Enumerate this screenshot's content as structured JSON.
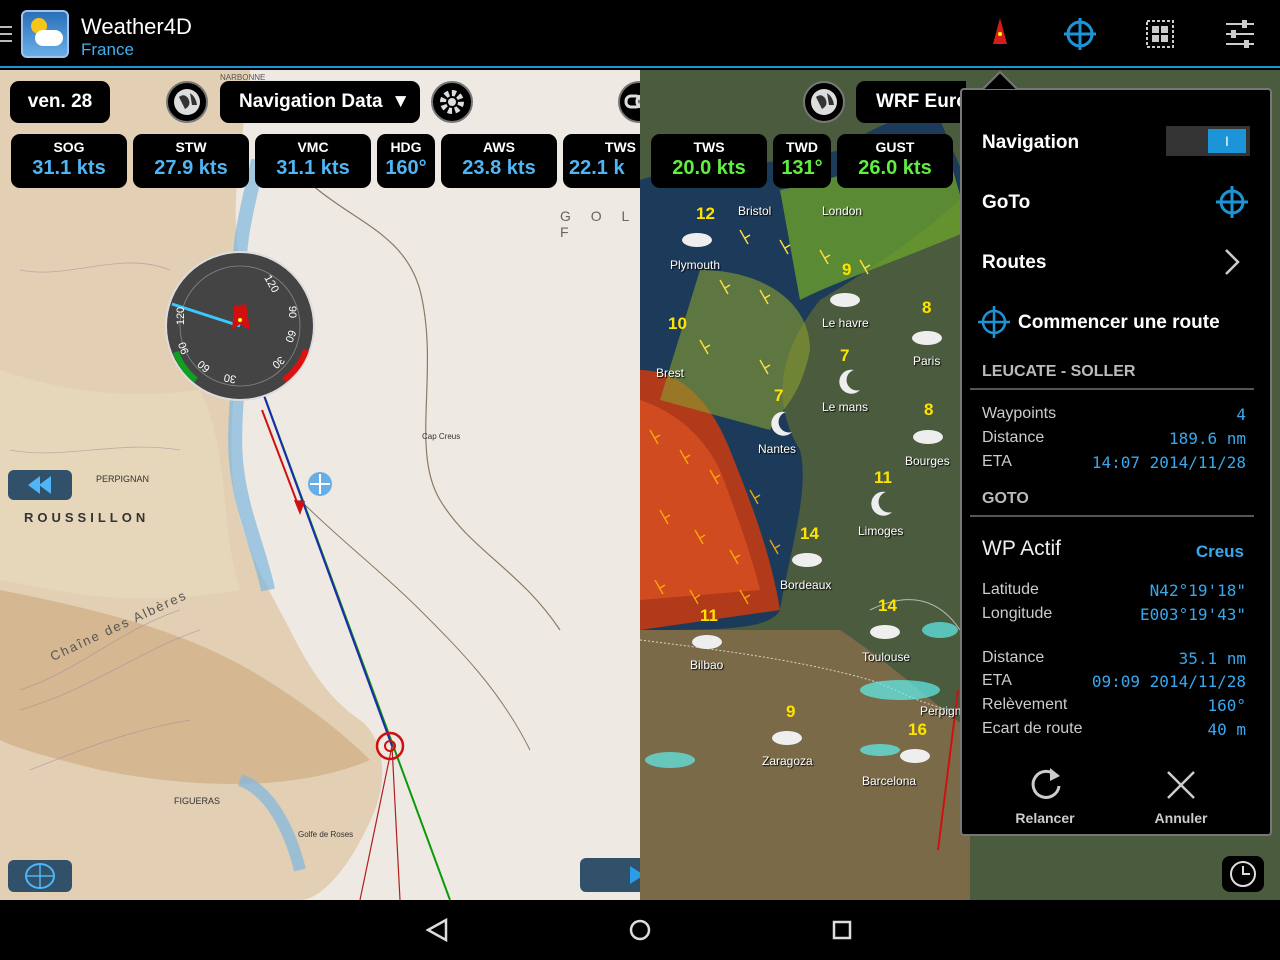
{
  "app": {
    "title": "Weather4D",
    "subtitle": "France"
  },
  "colors": {
    "accent": "#1b95d8",
    "value_blue": "#4fb5f5",
    "value_green": "#5fef3f"
  },
  "left": {
    "date": "ven. 28",
    "data_menu": "Navigation Data",
    "gauges": [
      {
        "label": "SOG",
        "value": "31.1 kts"
      },
      {
        "label": "STW",
        "value": "27.9 kts"
      },
      {
        "label": "VMC",
        "value": "31.1 kts"
      },
      {
        "label": "HDG",
        "value": "160°"
      },
      {
        "label": "AWS",
        "value": "23.8 kts"
      },
      {
        "label": "TWS",
        "value": "22.1 k"
      }
    ],
    "chart": {
      "region": "ROUSSILLON",
      "city1": "PERPIGNAN",
      "city2": "FIGUERAS",
      "place": "Golfe de Roses",
      "ridge": "Chaîne des Albères",
      "cape": "Cap Creus",
      "top_city": "NARBONNE",
      "sea": "G O L F"
    },
    "compass": [
      "120",
      "90",
      "60",
      "30",
      "90",
      "60",
      "30",
      "120"
    ]
  },
  "right": {
    "model": "WRF Euro",
    "gauges": [
      {
        "label": "TWS",
        "value": "20.0 kts"
      },
      {
        "label": "TWD",
        "value": "131°"
      },
      {
        "label": "GUST",
        "value": "26.0 kts"
      }
    ],
    "cities": [
      {
        "name": "Bristol",
        "temp": "12"
      },
      {
        "name": "London",
        "temp": ""
      },
      {
        "name": "Plymouth",
        "temp": ""
      },
      {
        "name": "Le havre",
        "temp": "9"
      },
      {
        "name": "Paris",
        "temp": "8"
      },
      {
        "name": "Brest",
        "temp": "10"
      },
      {
        "name": "Le mans",
        "temp": "7"
      },
      {
        "name": "Nantes",
        "temp": "7"
      },
      {
        "name": "Bourges",
        "temp": "8"
      },
      {
        "name": "Limoges",
        "temp": "11"
      },
      {
        "name": "Bordeaux",
        "temp": "14"
      },
      {
        "name": "Toulouse",
        "temp": "14"
      },
      {
        "name": "Bilbao",
        "temp": "11"
      },
      {
        "name": "Perpign",
        "temp": ""
      },
      {
        "name": "Zaragoza",
        "temp": "9"
      },
      {
        "name": "Barcelona",
        "temp": "16"
      }
    ]
  },
  "panel": {
    "nav_label": "Navigation",
    "nav_toggle": "I",
    "goto_label": "GoTo",
    "routes_label": "Routes",
    "start_route": "Commencer une route",
    "route_header": "LEUCATE - SOLLER",
    "route_rows": [
      {
        "k": "Waypoints",
        "v": "4"
      },
      {
        "k": "Distance",
        "v": "189.6 nm"
      },
      {
        "k": "ETA",
        "v": "14:07 2014/11/28"
      }
    ],
    "goto_header": "GOTO",
    "wp_label": "WP Actif",
    "wp_name": "Creus",
    "coords": [
      {
        "k": "Latitude",
        "v": "N42°19'18\""
      },
      {
        "k": "Longitude",
        "v": "E003°19'43\""
      }
    ],
    "wp_rows": [
      {
        "k": "Distance",
        "v": "35.1 nm"
      },
      {
        "k": "ETA",
        "v": "09:09 2014/11/28"
      },
      {
        "k": "Relèvement",
        "v": "160°"
      },
      {
        "k": "Ecart de route",
        "v": "40 m"
      }
    ],
    "restart": "Relancer",
    "cancel": "Annuler"
  }
}
